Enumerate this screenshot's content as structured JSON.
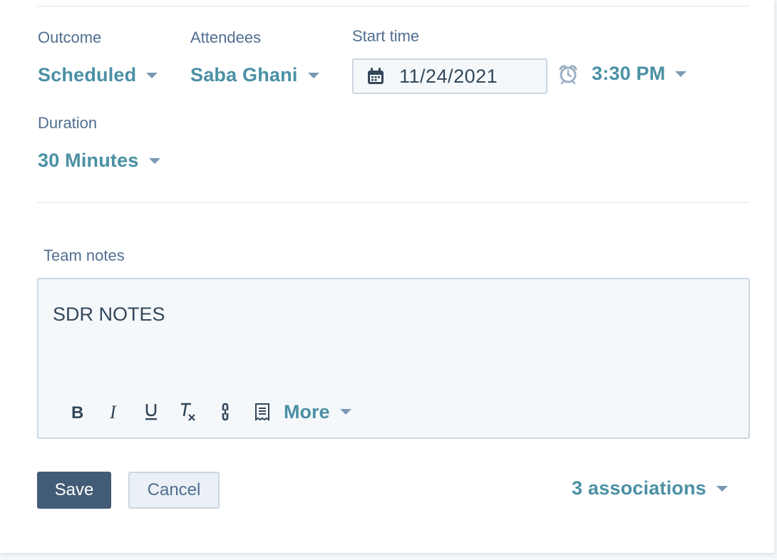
{
  "fields": {
    "outcome": {
      "label": "Outcome",
      "value": "Scheduled"
    },
    "attendees": {
      "label": "Attendees",
      "value": "Saba Ghani"
    },
    "start_time": {
      "label": "Start time",
      "date": "11/24/2021",
      "time": "3:30 PM"
    },
    "duration": {
      "label": "Duration",
      "value": "30 Minutes"
    }
  },
  "notes": {
    "label": "Team notes",
    "content": "SDR NOTES",
    "toolbar": {
      "items": [
        "bold-icon",
        "italic-icon",
        "underline-icon",
        "clear-format-icon",
        "link-icon",
        "snippet-icon"
      ],
      "more_label": "More"
    }
  },
  "actions": {
    "save_label": "Save",
    "cancel_label": "Cancel",
    "associations_label": "3 associations"
  },
  "colors": {
    "link": "#4a90a4",
    "primary_button": "#425b76",
    "text": "#33475b",
    "border": "#cbd6e2"
  }
}
